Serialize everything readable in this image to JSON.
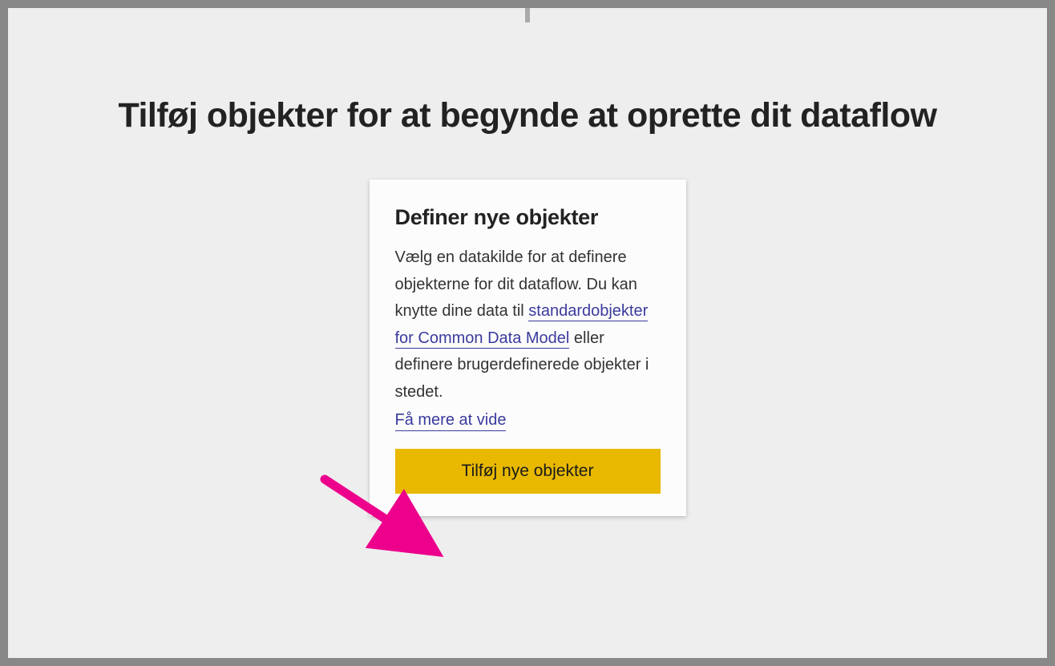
{
  "page": {
    "title": "Tilføj objekter for at begynde at oprette dit dataflow"
  },
  "card": {
    "title": "Definer nye objekter",
    "description_pre": "Vælg en datakilde for at definere objekterne for dit dataflow. Du kan knytte dine data til ",
    "description_link": "standardobjekter for Common Data Model",
    "description_post": " eller definere brugerdefinerede objekter i stedet.",
    "learn_more": "Få mere at vide",
    "button_label": "Tilføj nye objekter"
  },
  "colors": {
    "accent": "#e8b900",
    "link": "#3b3b9e",
    "annotation": "#ec008c"
  }
}
